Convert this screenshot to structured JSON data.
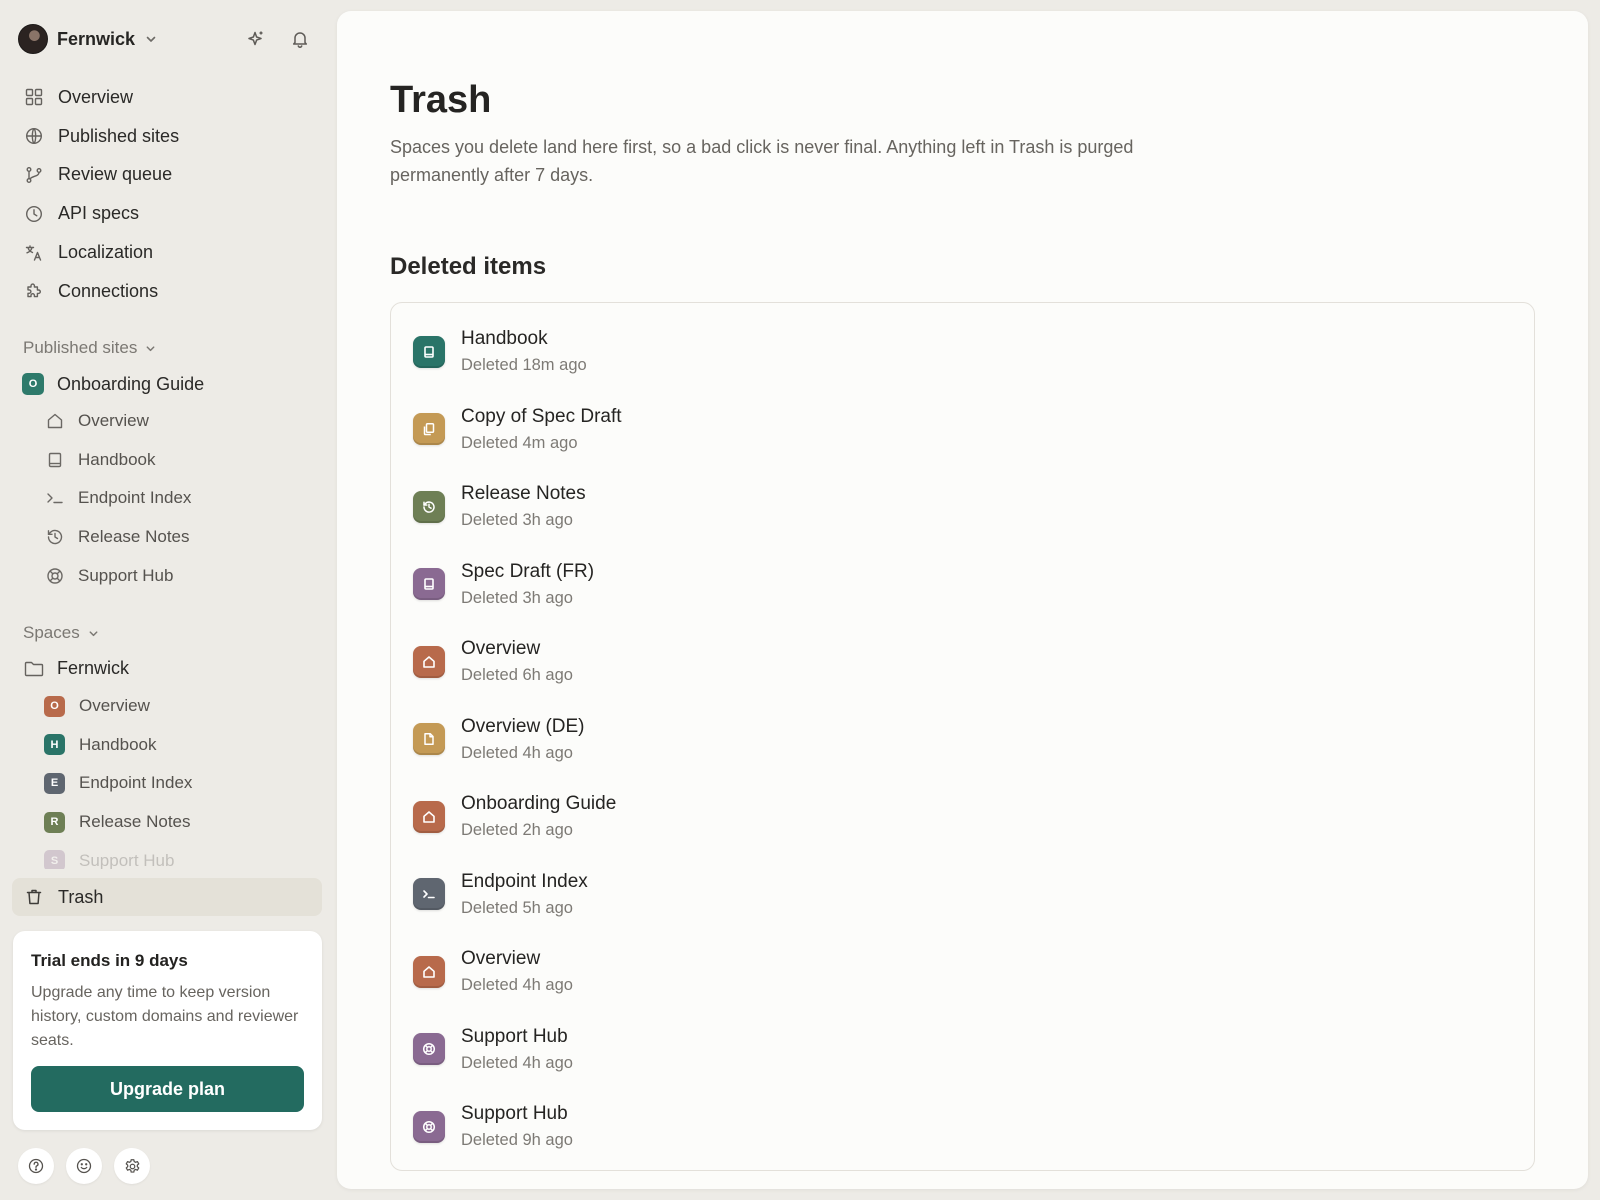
{
  "workspace": {
    "name": "Fernwick"
  },
  "nav": [
    {
      "label": "Overview",
      "icon": "grid-icon"
    },
    {
      "label": "Published sites",
      "icon": "globe-icon"
    },
    {
      "label": "Review queue",
      "icon": "branch-icon"
    },
    {
      "label": "API specs",
      "icon": "clock-icon"
    },
    {
      "label": "Localization",
      "icon": "translate-icon"
    },
    {
      "label": "Connections",
      "icon": "puzzle-icon"
    }
  ],
  "published_sites": {
    "header": "Published sites",
    "site": {
      "label": "Onboarding Guide",
      "badge": "O",
      "color": "#2E7A6B"
    },
    "pages": [
      {
        "label": "Overview",
        "icon": "home-icon"
      },
      {
        "label": "Handbook",
        "icon": "book-icon"
      },
      {
        "label": "Endpoint Index",
        "icon": "terminal-icon"
      },
      {
        "label": "Release Notes",
        "icon": "history-icon"
      },
      {
        "label": "Support Hub",
        "icon": "lifebuoy-icon"
      }
    ]
  },
  "spaces": {
    "header": "Spaces",
    "folder": {
      "label": "Fernwick",
      "icon": "folder-icon"
    },
    "items": [
      {
        "label": "Overview",
        "badge": "O",
        "color": "#B86A4B"
      },
      {
        "label": "Handbook",
        "badge": "H",
        "color": "#2A7468"
      },
      {
        "label": "Endpoint Index",
        "badge": "E",
        "color": "#5F6670"
      },
      {
        "label": "Release Notes",
        "badge": "R",
        "color": "#6E7F55"
      },
      {
        "label": "Support Hub",
        "badge": "S",
        "color": "#8F6B92"
      }
    ]
  },
  "trash_nav": {
    "label": "Trash"
  },
  "trial": {
    "title": "Trial ends in 9 days",
    "text": "Upgrade any time to keep version history, custom domains and reviewer seats.",
    "button": "Upgrade plan"
  },
  "page": {
    "title": "Trash",
    "description": "Spaces you delete land here first, so a bad click is never final. Anything left in Trash is purged permanently after 7 days.",
    "section_title": "Deleted items"
  },
  "deleted_items": [
    {
      "name": "Handbook",
      "meta": "Deleted 18m ago",
      "icon": "book-icon",
      "color": "#2A7468"
    },
    {
      "name": "Copy of Spec Draft",
      "meta": "Deleted 4m ago",
      "icon": "copy-icon",
      "color": "#C49A55"
    },
    {
      "name": "Release Notes",
      "meta": "Deleted 3h ago",
      "icon": "history-icon",
      "color": "#6E7F55"
    },
    {
      "name": "Spec Draft (FR)",
      "meta": "Deleted 3h ago",
      "icon": "book-icon",
      "color": "#8A6A92"
    },
    {
      "name": "Overview",
      "meta": "Deleted 6h ago",
      "icon": "home-icon",
      "color": "#B86A4B"
    },
    {
      "name": "Overview (DE)",
      "meta": "Deleted 4h ago",
      "icon": "file-icon",
      "color": "#C49A55"
    },
    {
      "name": "Onboarding Guide",
      "meta": "Deleted 2h ago",
      "icon": "home-icon",
      "color": "#B86A4B"
    },
    {
      "name": "Endpoint Index",
      "meta": "Deleted 5h ago",
      "icon": "terminal-icon",
      "color": "#5F6670"
    },
    {
      "name": "Overview",
      "meta": "Deleted 4h ago",
      "icon": "home-icon",
      "color": "#B86A4B"
    },
    {
      "name": "Support Hub",
      "meta": "Deleted 4h ago",
      "icon": "lifebuoy-icon",
      "color": "#8A6A92"
    },
    {
      "name": "Support Hub",
      "meta": "Deleted 9h ago",
      "icon": "lifebuoy-icon",
      "color": "#8A6A92"
    }
  ]
}
